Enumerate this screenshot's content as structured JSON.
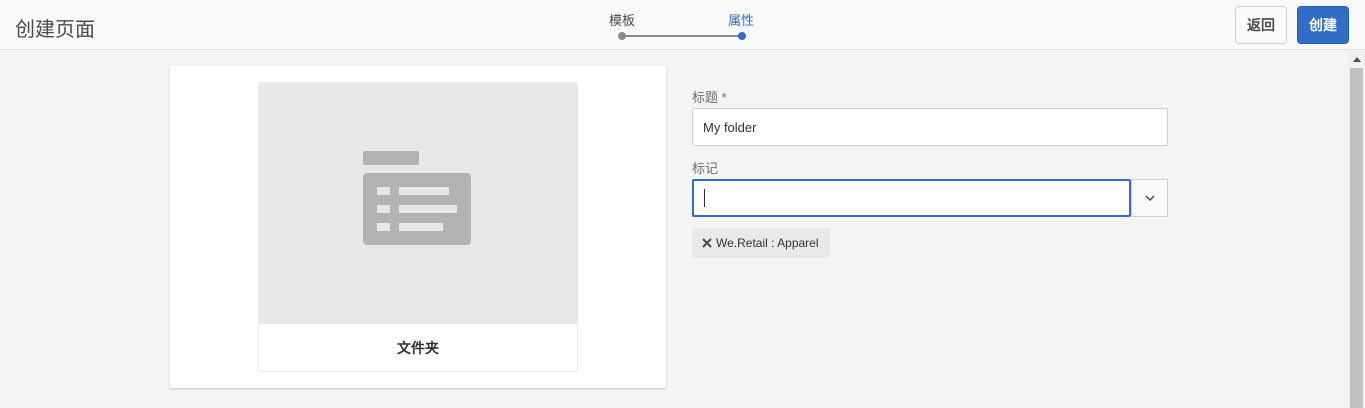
{
  "header": {
    "page_title": "创建页面",
    "wizard_steps": [
      "模板",
      "属性"
    ],
    "active_step": 2,
    "back_label": "返回",
    "create_label": "创建"
  },
  "template_card": {
    "icon": "folder-icon",
    "title": "文件夹"
  },
  "form": {
    "title_label": "标题 *",
    "title_value": "My folder",
    "tags_label": "标记",
    "tags_value": "",
    "tags": [
      {
        "label": "We.Retail : Apparel"
      }
    ]
  },
  "colors": {
    "accent": "#326ec8",
    "background": "#f4f4f4"
  }
}
